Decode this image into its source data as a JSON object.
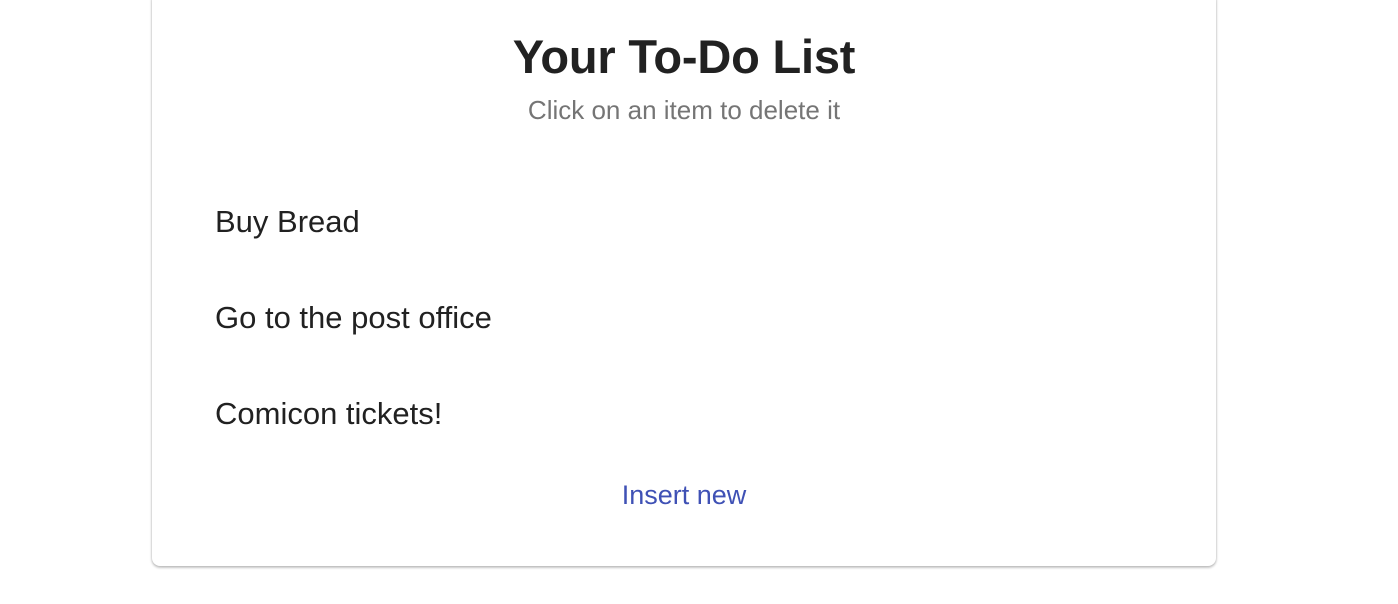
{
  "card": {
    "title": "Your To-Do List",
    "subtitle": "Click on an item to delete it"
  },
  "todos": [
    {
      "label": "Buy Bread"
    },
    {
      "label": "Go to the post office"
    },
    {
      "label": "Comicon tickets!"
    }
  ],
  "actions": {
    "insert_label": "Insert new"
  },
  "colors": {
    "accent": "#3f51b5",
    "text_primary": "#212121",
    "text_secondary": "#757575",
    "background": "#ffffff"
  }
}
